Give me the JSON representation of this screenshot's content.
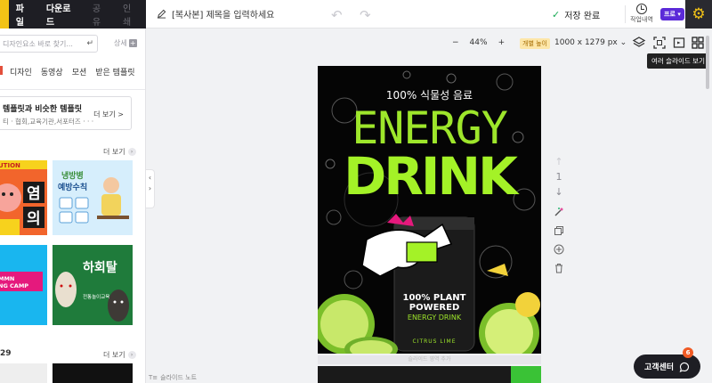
{
  "menu": {
    "file": "파일",
    "download": "다운로드",
    "share": "공유",
    "print": "인쇄"
  },
  "document": {
    "title": "[복사본] 제목을 입력하세요",
    "save_status": "저장 완료"
  },
  "toolbar": {
    "history_label": "작업내역",
    "pro_label": "프로",
    "zoom_value": "44%",
    "zoom_minus": "−",
    "zoom_plus": "+",
    "dimension_badge": "개별 높이",
    "canvas_size": "1000 x 1279 px",
    "tooltip": "여러 슬라이드 보기"
  },
  "left_panel": {
    "search_placeholder": "디자인요소 바로 찾기...",
    "detail_label": "상세",
    "tabs": [
      "디자인",
      "동영상",
      "모션",
      "받은 템플릿"
    ],
    "similar_title": "템플릿과 비슷한 템플릿",
    "similar_desc": "티 · 협회,교육기관,서포터즈 · · ·",
    "similar_more": "더 보기 >",
    "more_label": "더 보기",
    "section_number": "29",
    "thumbnails": [
      {
        "title_1": "UTION",
        "title_2": "염",
        "title_3": "의"
      },
      {
        "title_1": "냉방병",
        "title_2": "예방수칙"
      },
      {
        "title_1": "MMN",
        "title_2": "NG CAMP"
      },
      {
        "title_1": "하회탈",
        "title_2": "전통놀이교육"
      }
    ]
  },
  "slide": {
    "page_number": "1",
    "slide_note": "슬라이드 노트",
    "next_slide_hint": "슬라이드 영역 추가"
  },
  "poster": {
    "subtitle": "100% 식물성 음료",
    "headline_1": "ENERGY",
    "headline_2": "DRINK",
    "can_line_1": "100% PLANT",
    "can_line_2": "POWERED",
    "can_line_3": "ENERGY DRINK",
    "can_flavor": "CITRUS LIME"
  },
  "support": {
    "label": "고객센터",
    "badge": "6"
  },
  "colors": {
    "accent_yellow": "#f3c316",
    "lime": "#9ee62b",
    "pro_purple": "#5b2ad8",
    "dark": "#1e1e24"
  }
}
